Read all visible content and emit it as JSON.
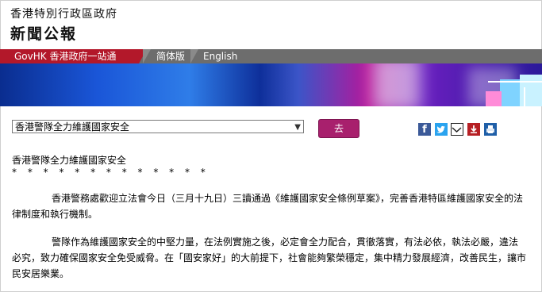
{
  "header": {
    "gov_name": "香港特別行政區政府",
    "press_release": "新聞公報"
  },
  "nav": {
    "govhk": "GovHK 香港政府一站通",
    "simplified": "简体版",
    "english": "English"
  },
  "controls": {
    "dropdown_selected": "香港警隊全力維護國家安全",
    "go_button": "去"
  },
  "share_icons": [
    "facebook-icon",
    "twitter-icon",
    "email-icon",
    "save-icon",
    "print-icon"
  ],
  "article": {
    "title": "香港警隊全力維護國家安全",
    "stars": "* * * * * * * * * * * * *",
    "paragraphs": [
      "香港警務處歡迎立法會今日（三月十九日）三讀通過《維護國家安全條例草案》，完善香港特區維護國家安全的法律制度和執行機制。",
      "警隊作為維護國家安全的中堅力量，在法例實施之後，必定會全力配合，貫徹落實，有法必依，執法必嚴，違法必究，致力確保國家安全免受威脅。在「國安家好」的大前提下，社會能夠繁榮穩定，集中精力發展經濟，改善民生，讓市民安居樂業。"
    ]
  },
  "colors": {
    "nav_red": "#b3182a",
    "nav_gray": "#6d6d6d",
    "button_magenta": "#a8206d"
  }
}
